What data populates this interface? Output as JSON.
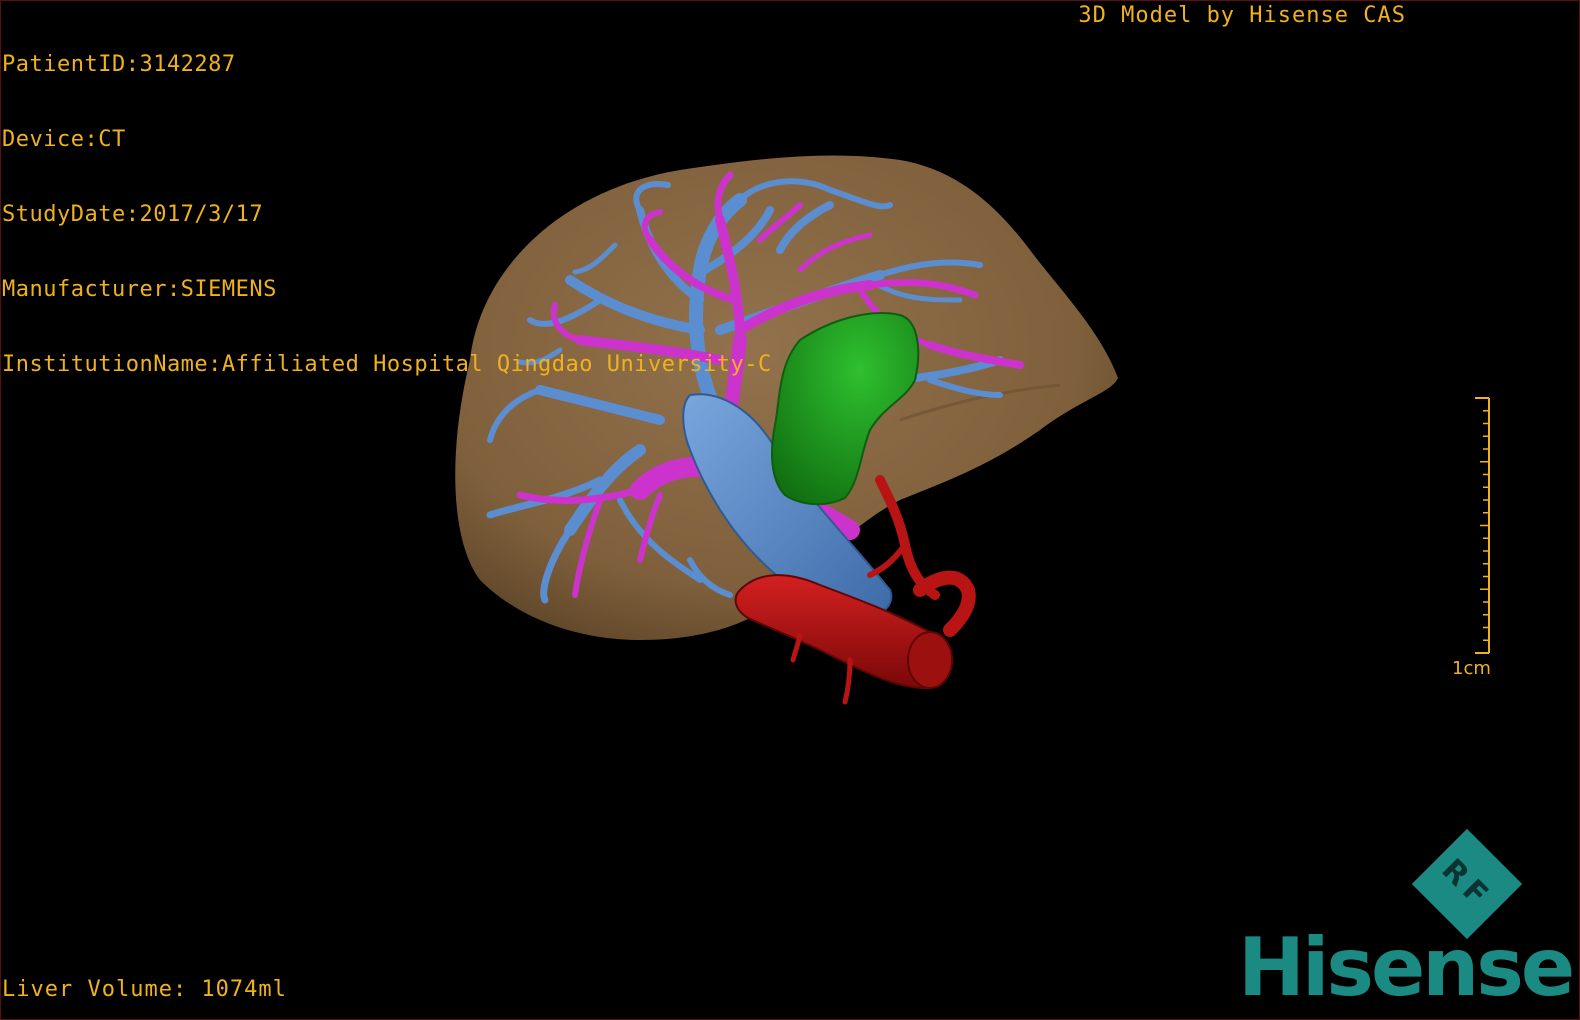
{
  "dicom_info": {
    "patient_id": "PatientID:3142287",
    "device": "Device:CT",
    "study_date": "StudyDate:2017/3/17",
    "manufacturer": "Manufacturer:SIEMENS",
    "institution": "InstitutionName:Affiliated Hospital Qingdao University-C"
  },
  "credit": "3D Model by Hisense CAS",
  "liver_volume": "Liver Volume: 1074ml",
  "scale_bar": {
    "label": "1cm"
  },
  "logo": {
    "badge": "RF",
    "wordmark": "Hisense"
  },
  "colors": {
    "overlay_text": "#f0b21c",
    "liver": "#8c6a45",
    "portal_vein": "#cc33cc",
    "hepatic_vein": "#5b8ed1",
    "tumor": "#1c9c1c",
    "artery": "#b81414",
    "logo": "#1b8a83",
    "background": "#000000"
  }
}
